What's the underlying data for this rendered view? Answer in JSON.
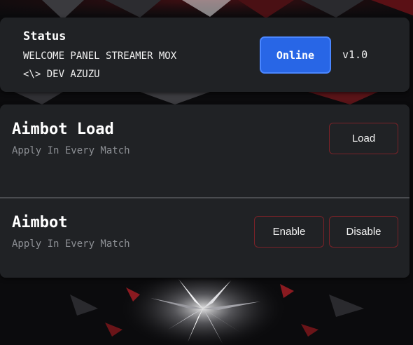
{
  "status": {
    "title": "Status",
    "line1": "WELCOME PANEL STREAMER MOX",
    "line2": "<\\> DEV AZUZU",
    "online_label": "Online",
    "version": "v1.0"
  },
  "aimbot_load": {
    "title": "Aimbot Load",
    "subtitle": "Apply In Every Match",
    "load_label": "Load"
  },
  "aimbot": {
    "title": "Aimbot",
    "subtitle": "Apply In Every Match",
    "enable_label": "Enable",
    "disable_label": "Disable"
  },
  "colors": {
    "accent_blue": "#2866e6",
    "card_bg": "#202225",
    "button_border_red": "#7a2228",
    "background": "#0b0b0d"
  }
}
